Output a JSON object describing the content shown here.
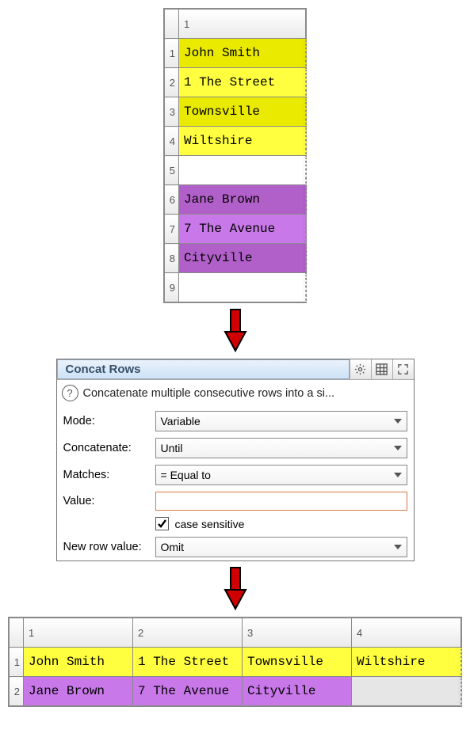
{
  "input_grid": {
    "col_headers": [
      "1"
    ],
    "rows": [
      {
        "n": "1",
        "v": "John Smith",
        "cls": "y1"
      },
      {
        "n": "2",
        "v": "1 The Street",
        "cls": "y2"
      },
      {
        "n": "3",
        "v": "Townsville",
        "cls": "y1"
      },
      {
        "n": "4",
        "v": "Wiltshire",
        "cls": "y2"
      },
      {
        "n": "5",
        "v": "",
        "cls": ""
      },
      {
        "n": "6",
        "v": "Jane Brown",
        "cls": "p1"
      },
      {
        "n": "7",
        "v": "7 The Avenue",
        "cls": "p2"
      },
      {
        "n": "8",
        "v": "Cityville",
        "cls": "p1"
      },
      {
        "n": "9",
        "v": "",
        "cls": ""
      }
    ]
  },
  "panel": {
    "title": "Concat Rows",
    "desc": "Concatenate multiple consecutive rows into a si...",
    "mode_label": "Mode:",
    "mode_value": "Variable",
    "concat_label": "Concatenate:",
    "concat_value": "Until",
    "matches_label": "Matches:",
    "matches_value": "=  Equal to",
    "value_label": "Value:",
    "value_value": "",
    "case_label": "case sensitive",
    "case_checked": true,
    "newrow_label": "New row value:",
    "newrow_value": "Omit"
  },
  "output_grid": {
    "col_headers": [
      "1",
      "2",
      "3",
      "4"
    ],
    "rows": [
      {
        "n": "1",
        "cls": "y2",
        "cells": [
          "John Smith",
          "1 The Street",
          "Townsville",
          "Wiltshire"
        ]
      },
      {
        "n": "2",
        "cls": "p2",
        "cells": [
          "Jane Brown",
          "7 The Avenue",
          "Cityville",
          ""
        ]
      }
    ]
  }
}
